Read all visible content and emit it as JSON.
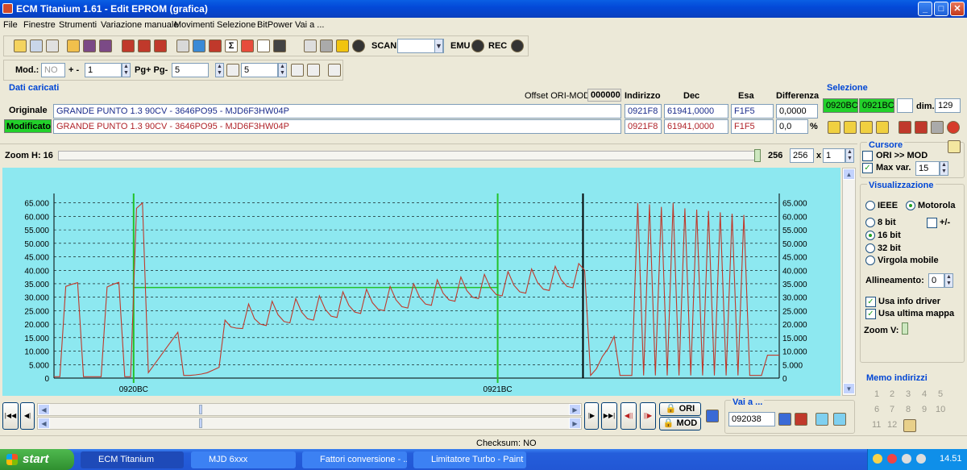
{
  "window": {
    "title": "ECM Titanium 1.61 - Edit EPROM (grafica)",
    "min": "_",
    "max": "□",
    "close": "✕"
  },
  "menu": [
    "File",
    "Finestre",
    "Strumenti",
    "Variazione manuale",
    "Movimenti",
    "Selezione",
    "BitPower",
    "Vai a ..."
  ],
  "toolbar": {
    "scan": "SCAN",
    "emu": "EMU",
    "rec": "REC"
  },
  "toolbar2": {
    "mod_label": "Mod.:",
    "mod_value": "NO",
    "plusminus": "+ -",
    "pm_value": "1",
    "pg_label": "Pg+ Pg-",
    "pg_value": "5",
    "p_value": "5"
  },
  "dati": {
    "title": "Dati caricati",
    "offset_label": "Offset ORI-MOD",
    "offset_value": "000000",
    "col_indirizzo": "Indirizzo",
    "col_dec": "Dec",
    "col_esa": "Esa",
    "col_diff": "Differenza",
    "originale": {
      "label": "Originale",
      "desc": "GRANDE PUNTO 1.3 90CV - 3646PO95 - MJD6F3HW04P",
      "addr": "0921F8",
      "dec": "61941,0000",
      "esa": "F1F5",
      "diff": "0,0000"
    },
    "modificato": {
      "label": "Modificato",
      "desc": "GRANDE PUNTO 1.3 90CV - 3646PO95 - MJD6F3HW04P",
      "addr": "0921F8",
      "dec": "61941,0000",
      "esa": "F1F5",
      "diff": "0,0",
      "pct": "%"
    }
  },
  "selezione": {
    "title": "Selezione",
    "start": "0920BC",
    "end": "0921BC",
    "dim_label": "dim.",
    "dim_value": "129"
  },
  "zoom": {
    "label": "Zoom H: 16",
    "value_text": "256",
    "value_box": "256",
    "x": "x",
    "mult": "1"
  },
  "cursore": {
    "title": "Cursore",
    "ori_mod": "ORI >> MOD",
    "max_var": "Max var.",
    "max_var_value": "15"
  },
  "visual": {
    "title": "Visualizzazione",
    "ieee": "IEEE",
    "motorola": "Motorola",
    "b8": "8 bit",
    "pm": "+/-",
    "b16": "16 bit",
    "b32": "32 bit",
    "virgola": "Virgola mobile",
    "allineamento": "Allineamento:",
    "all_value": "0",
    "usa_info": "Usa info driver",
    "usa_ultima": "Usa ultima mappa",
    "zoomv": "Zoom V:"
  },
  "memo": {
    "title": "Memo indirizzi",
    "numbers": [
      "1",
      "2",
      "3",
      "4",
      "5",
      "6",
      "7",
      "8",
      "9",
      "10",
      "11",
      "12"
    ]
  },
  "nav": {
    "ori": "ORI",
    "mod": "MOD",
    "vai_title": "Vai a ...",
    "vai_value": "092038"
  },
  "status": {
    "checksum": "Checksum: NO"
  },
  "taskbar": {
    "start": "start",
    "tasks": [
      "ECM Titanium",
      "MJD 6xxx",
      "Fattori conversione - ...",
      "Limitatore Turbo - Paint"
    ],
    "clock": "14.51"
  },
  "colors": {
    "plot_bg": "#8de8f0",
    "series": "#c0392b",
    "selection": "#22c22a",
    "cursor": "#000000"
  },
  "chart_data": {
    "type": "line",
    "yticks": [
      "0",
      "5.000",
      "10.000",
      "15.000",
      "20.000",
      "25.000",
      "30.000",
      "35.000",
      "40.000",
      "45.000",
      "50.000",
      "55.000",
      "60.000",
      "65.000"
    ],
    "ylim": [
      0,
      67000
    ],
    "xlim": [
      0,
      255
    ],
    "x_tick_labels": [
      {
        "x": 28,
        "label": "0920BC"
      },
      {
        "x": 156,
        "label": "0921BC"
      }
    ],
    "selection_range": [
      28,
      156
    ],
    "selection_level": 33600,
    "cursor_x": 186,
    "values": [
      500,
      500,
      34000,
      34800,
      35400,
      500,
      500,
      500,
      500,
      33800,
      34800,
      35500,
      500,
      500,
      63000,
      65000,
      2000,
      5000,
      8000,
      11000,
      14000,
      17000,
      1000,
      1000,
      1200,
      1500,
      2000,
      3000,
      4000,
      21500,
      19000,
      18500,
      18400,
      27500,
      22000,
      20000,
      19500,
      28500,
      23500,
      21000,
      20500,
      29500,
      24500,
      22000,
      21500,
      30500,
      25500,
      23000,
      22500,
      32000,
      27000,
      24500,
      24000,
      33000,
      28000,
      25500,
      25000,
      34000,
      29000,
      26500,
      26000,
      35000,
      30000,
      27500,
      27000,
      36500,
      31500,
      29000,
      28500,
      37500,
      32500,
      30000,
      29500,
      38500,
      33500,
      31000,
      30500,
      39500,
      34500,
      32000,
      31500,
      40500,
      35500,
      33000,
      32500,
      41500,
      36500,
      34000,
      33500,
      42500,
      40000,
      1000,
      3500,
      8000,
      11000,
      15500,
      1000,
      1000,
      1000,
      65000,
      1000,
      64500,
      1000,
      63500,
      1000,
      65000,
      1000,
      63000,
      1000,
      62500,
      1000,
      62000,
      1000,
      61500,
      1000,
      61000,
      1000,
      60500,
      1000,
      1000,
      1000,
      8500,
      8500,
      8500
    ]
  }
}
